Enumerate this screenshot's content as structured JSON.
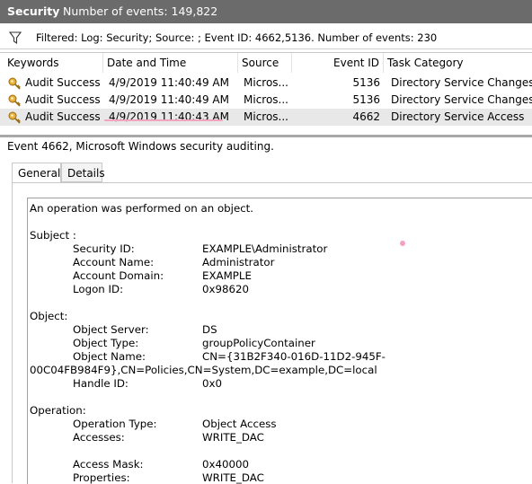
{
  "titlebar": {
    "title": "Security",
    "subtitle": "Number of events: 149,822"
  },
  "filter": {
    "text": "Filtered: Log: Security; Source: ; Event ID: 4662,5136. Number of events: 230",
    "icon": "filter-icon"
  },
  "columns": [
    "Keywords",
    "Date and Time",
    "Source",
    "Event ID",
    "Task Category"
  ],
  "rows": [
    {
      "keyword": "Audit Success",
      "datetime": "4/9/2019 11:40:49 AM",
      "source": "Micros...",
      "event_id": "5136",
      "category": "Directory Service Changes"
    },
    {
      "keyword": "Audit Success",
      "datetime": "4/9/2019 11:40:49 AM",
      "source": "Micros...",
      "event_id": "5136",
      "category": "Directory Service Changes"
    },
    {
      "keyword": "Audit Success",
      "datetime": "4/9/2019 11:40:43 AM",
      "source": "Micros...",
      "event_id": "4662",
      "category": "Directory Service Access"
    }
  ],
  "event_header": "Event 4662, Microsoft Windows security auditing.",
  "tabs": {
    "general": "General",
    "details": "Details"
  },
  "description": {
    "intro": "An operation was performed on an object.",
    "subject_header": "Subject :",
    "subject": [
      {
        "label": "Security ID:",
        "value": "EXAMPLE\\Administrator"
      },
      {
        "label": "Account Name:",
        "value": "Administrator"
      },
      {
        "label": "Account Domain:",
        "value": "EXAMPLE"
      },
      {
        "label": "Logon ID:",
        "value": "0x98620"
      }
    ],
    "object_header": "Object:",
    "object": [
      {
        "label": "Object Server:",
        "value": "DS"
      },
      {
        "label": "Object Type:",
        "value": "groupPolicyContainer"
      },
      {
        "label": "Object Name:",
        "value": "CN={31B2F340-016D-11D2-945F-"
      }
    ],
    "object_name_wrap": "00C04FB984F9},CN=Policies,CN=System,DC=example,DC=local",
    "handle": {
      "label": "Handle ID:",
      "value": "0x0"
    },
    "operation_header": "Operation:",
    "operation": [
      {
        "label": "Operation Type:",
        "value": "Object Access"
      },
      {
        "label": "Accesses:",
        "value": "WRITE_DAC"
      }
    ],
    "access_mask": {
      "label": "Access Mask:",
      "value": "0x40000"
    },
    "properties": {
      "label": "Properties:",
      "value": "WRITE_DAC"
    }
  },
  "colors": {
    "titlebar": "#6b6b6b",
    "selected_row": "#e8e8e8",
    "underline": "#f2a3c0"
  }
}
